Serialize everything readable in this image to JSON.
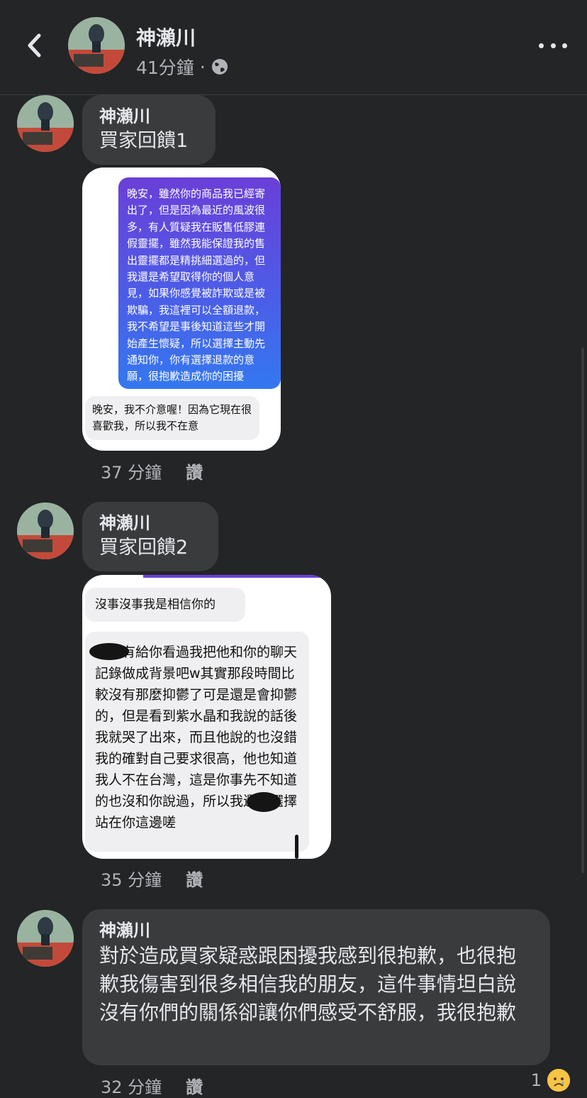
{
  "header": {
    "name": "神瀨川",
    "time": "41分鐘",
    "separator": "·",
    "privacy_icon": "globe-icon",
    "back_icon": "chevron-left-icon",
    "more_icon": "more-horizontal-icon"
  },
  "comments": [
    {
      "name": "神瀨川",
      "text": "買家回饋1",
      "image": {
        "outgoing": "晚安，雖然你的商品我已經寄出了，但是因為最近的風波很多，有人質疑我在販售低膠連假靈擺，雖然我能保證我的售出靈擺都是精挑細選過的，但我還是希望取得你的個人意見，如果你感覺被詐欺或是被欺騙，我這裡可以全額退款，我不希望是事後知道這些才開始產生懷疑，所以選擇主動先通知你，你有選擇退款的意願，很抱歉造成你的困擾",
        "reply": "晚安，我不介意喔！因為它現在很喜歡我，所以我不在意"
      },
      "time": "37 分鐘",
      "like": "讚"
    },
    {
      "name": "神瀨川",
      "text": "買家回饋2",
      "image": {
        "reply1": "沒事沒事我是相信你的",
        "reply2": "應該有給你看過我把他和你的聊天記錄做成背景吧w其實那段時間比較沒有那麼抑鬱了可是還是會抑鬱的，但是看到紫水晶和我說的話後我就哭了出來，而且他說的也沒錯我的確對自己要求很高，他也知道我人不在台灣，這是你事先不知道的也沒和你說過，所以我還是選擇站在你這邊嗟"
      },
      "time": "35 分鐘",
      "like": "讚"
    },
    {
      "name": "神瀨川",
      "text": "對於造成買家疑惑跟困擾我感到很抱歉，也很抱歉我傷害到很多相信我的朋友，這件事情坦白說沒有你們的關係卻讓你們感受不舒服，我很抱歉",
      "time": "32 分鐘",
      "like": "讚",
      "reaction_count": "1",
      "reaction_icon": "sad-emoji-icon"
    }
  ]
}
